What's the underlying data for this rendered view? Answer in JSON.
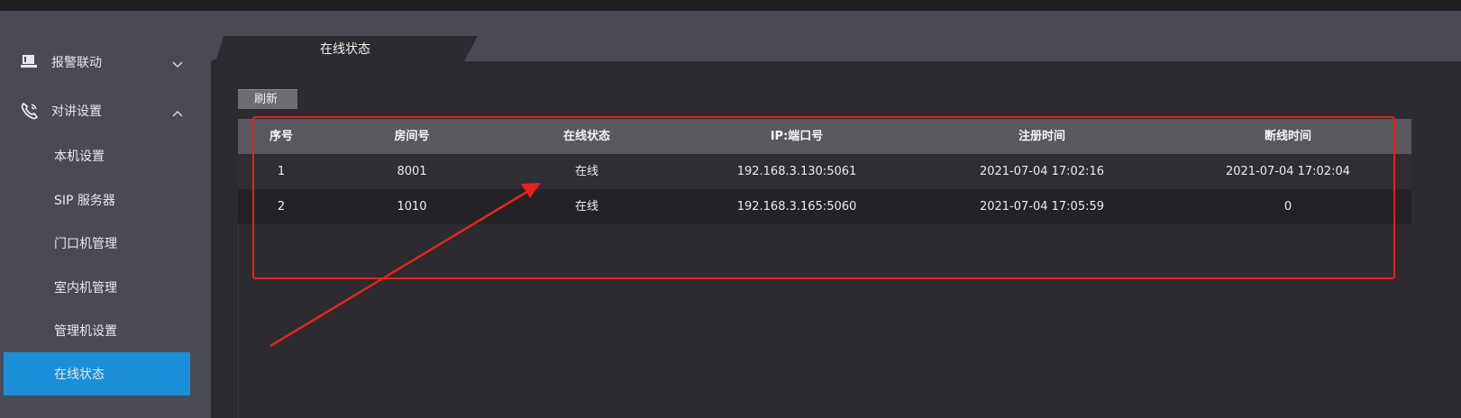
{
  "sidebar": {
    "groups": [
      {
        "label": "报警联动",
        "icon": "intercom-device-icon",
        "expanded": false
      },
      {
        "label": "对讲设置",
        "icon": "phone-call-icon",
        "expanded": true
      }
    ],
    "items": [
      {
        "label": "本机设置"
      },
      {
        "label": "SIP 服务器"
      },
      {
        "label": "门口机管理"
      },
      {
        "label": "室内机管理"
      },
      {
        "label": "管理机设置"
      },
      {
        "label": "在线状态",
        "active": true
      }
    ]
  },
  "tab": {
    "label": "在线状态"
  },
  "toolbar": {
    "refresh_label": "刷新"
  },
  "table": {
    "headers": [
      "序号",
      "房间号",
      "在线状态",
      "IP:端口号",
      "注册时间",
      "断线时间"
    ],
    "rows": [
      [
        "1",
        "8001",
        "在线",
        "192.168.3.130:5061",
        "2021-07-04 17:02:16",
        "2021-07-04 17:02:04"
      ],
      [
        "2",
        "1010",
        "在线",
        "192.168.3.165:5060",
        "2021-07-04 17:05:59",
        "0"
      ]
    ]
  },
  "colors": {
    "accent": "#1a8ed8",
    "annotation": "#e8201e",
    "header_bg": "#58585e",
    "sidebar_bg": "#4a4a55",
    "content_bg": "#2b2b30"
  }
}
